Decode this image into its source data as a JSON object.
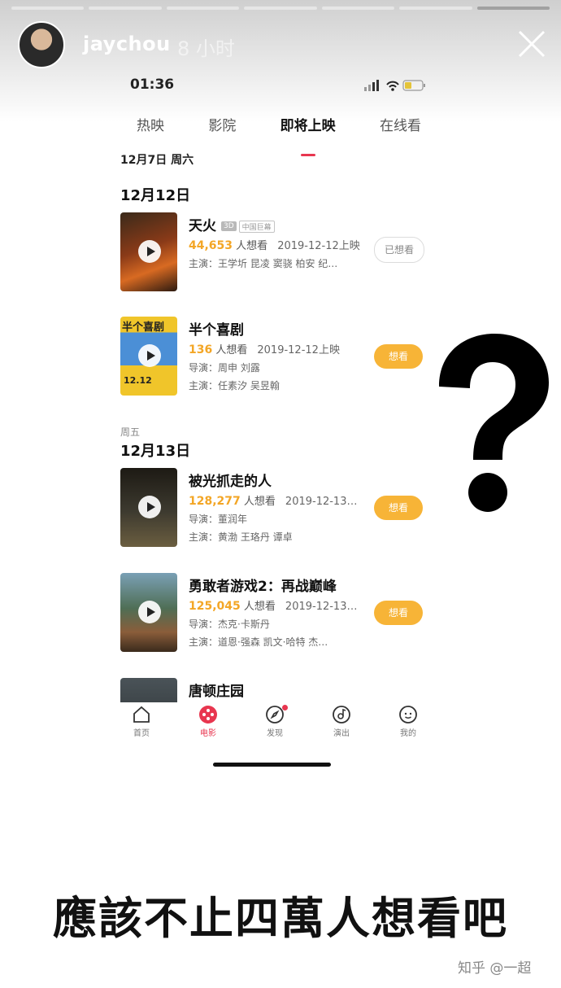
{
  "story": {
    "username": "jaychou",
    "time_ago": "8 小时",
    "caption": "應該不止四萬人想看吧",
    "watermark": "知乎 @一超"
  },
  "phone": {
    "status_time": "01:36",
    "tabs": [
      {
        "label": "热映"
      },
      {
        "label": "影院"
      },
      {
        "label": "即将上映",
        "active": true
      },
      {
        "label": "在线看"
      }
    ],
    "date_sub": "12月7日 周六",
    "groups": [
      {
        "date": "12月12日"
      },
      {
        "weekday": "周五",
        "date": "12月13日"
      }
    ],
    "movies": [
      {
        "title": "天火",
        "tag_3d": "3D",
        "tag_big": "中国巨幕",
        "want_count": "44,653",
        "want_suffix": "人想看",
        "release": "2019-12-12上映",
        "cast": "主演：王学圻 昆凌 窦骁 柏安 纪…",
        "button": "已想看"
      },
      {
        "title": "半个喜剧",
        "want_count": "136",
        "want_suffix": "人想看",
        "release": "2019-12-12上映",
        "director": "导演：周申 刘露",
        "cast": "主演：任素汐 吴昱翰",
        "button": "想看",
        "poster_text": "半个喜剧",
        "poster_date": "12.12"
      },
      {
        "title": "被光抓走的人",
        "want_count": "128,277",
        "want_suffix": "人想看",
        "release": "2019-12-13…",
        "director": "导演：董润年",
        "cast": "主演：黄渤 王珞丹 谭卓",
        "button": "想看"
      },
      {
        "title": "勇敢者游戏2：再战巅峰",
        "want_count": "125,045",
        "want_suffix": "人想看",
        "release": "2019-12-13…",
        "director": "导演：杰克·卡斯丹",
        "cast": "主演：道恩·强森 凯文·哈特 杰…",
        "button": "想看"
      },
      {
        "title": "唐顿庄园"
      }
    ],
    "nav": [
      {
        "label": "首页",
        "icon": "home-icon"
      },
      {
        "label": "电影",
        "icon": "film-icon",
        "active": true
      },
      {
        "label": "发现",
        "icon": "compass-icon",
        "badge": true
      },
      {
        "label": "演出",
        "icon": "music-icon"
      },
      {
        "label": "我的",
        "icon": "profile-icon"
      }
    ]
  },
  "colors": {
    "accent": "#e8364f",
    "want_button": "#f7b437",
    "want_count": "#f3a626"
  }
}
